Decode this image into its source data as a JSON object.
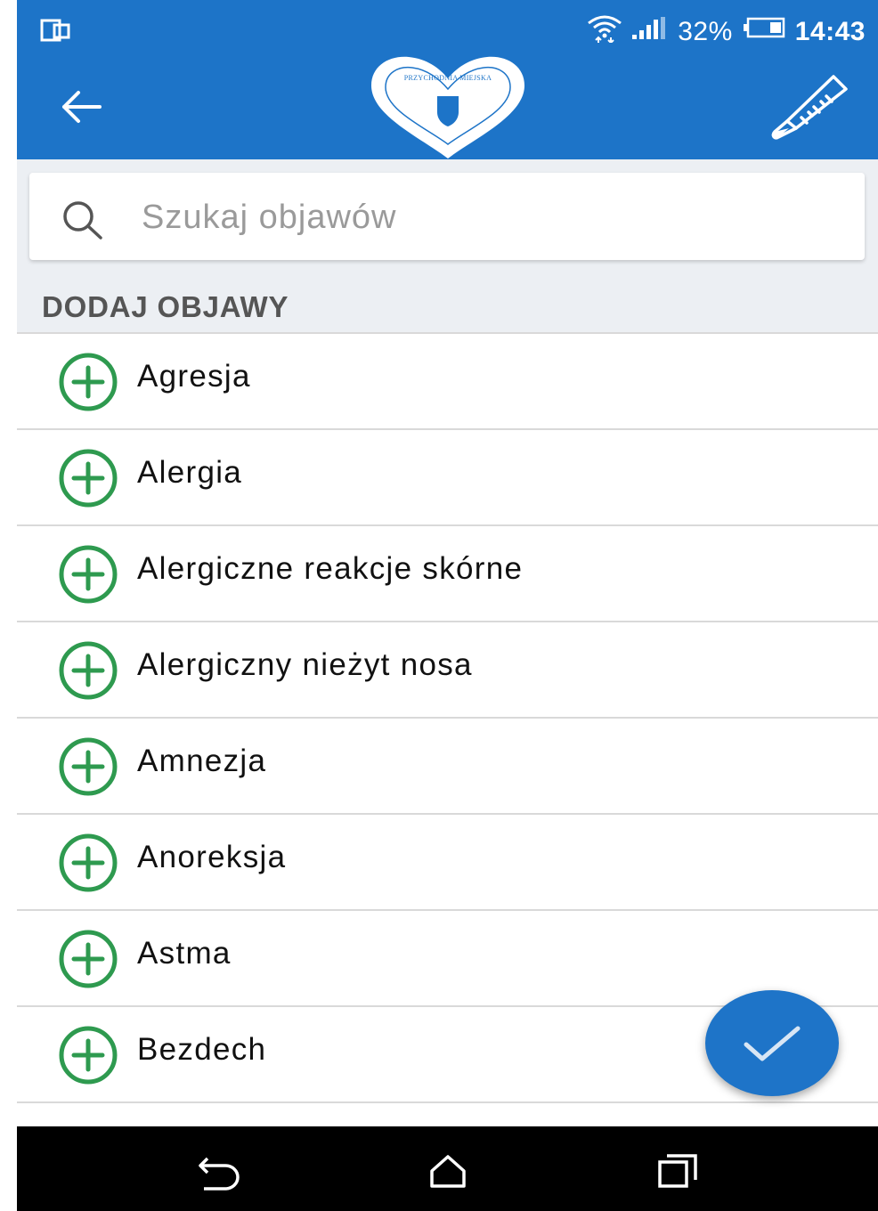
{
  "status_bar": {
    "battery_percent": "32%",
    "time": "14:43",
    "icons": [
      "dual-screen-icon",
      "wifi-icon",
      "signal-icon",
      "battery-icon"
    ]
  },
  "header": {
    "logo_text": "PRZYCHODNIA MIEJSKA",
    "icons": [
      "back-arrow-icon",
      "thermometer-icon"
    ]
  },
  "search": {
    "placeholder": "Szukaj objawów",
    "value": ""
  },
  "section_title": "DODAJ OBJAWY",
  "symptoms": [
    {
      "label": "Agresja"
    },
    {
      "label": "Alergia"
    },
    {
      "label": "Alergiczne reakcje skórne"
    },
    {
      "label": "Alergiczny nieżyt nosa"
    },
    {
      "label": "Amnezja"
    },
    {
      "label": "Anoreksja"
    },
    {
      "label": "Astma"
    },
    {
      "label": "Bezdech"
    }
  ],
  "colors": {
    "primary": "#1d74c8",
    "add_icon": "#2e9a4f",
    "list_divider": "#d9d9d9",
    "search_bg": "#eceff3"
  },
  "fab": {
    "icon": "check-icon"
  },
  "nav_bar": {
    "icons": [
      "nav-back-icon",
      "nav-home-icon",
      "nav-recents-icon"
    ]
  }
}
